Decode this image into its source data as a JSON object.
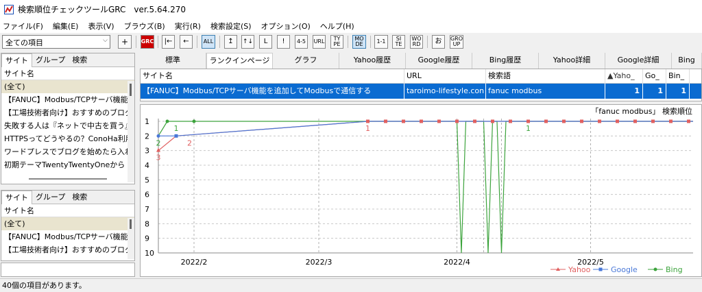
{
  "window": {
    "title": "検索順位チェックツールGRC　ver.5.64.270"
  },
  "menu": [
    "ファイル(F)",
    "編集(E)",
    "表示(V)",
    "ブラウズ(B)",
    "実行(R)",
    "検索設定(S)",
    "オプション(O)",
    "ヘルプ(H)"
  ],
  "toolbar": {
    "combo_value": "全ての項目",
    "buttons": [
      "+",
      "GRC",
      "|←",
      "←",
      "ALL",
      "↥",
      "↑↓",
      "L",
      "!",
      "4-5",
      "URL",
      "TY PE",
      "MO DE",
      "1-1",
      "SI TE",
      "WO RD",
      "お",
      "GRO UP"
    ]
  },
  "left_panel_top": {
    "tabs": [
      "サイト",
      "グループ",
      "検索"
    ],
    "header": "サイト名",
    "items": [
      "(全て)",
      "【FANUC】Modbus/TCPサーバ機能",
      "【工場技術者向け】おすすめのブログ立",
      "失敗する人は『ネットで中古を買う』|",
      "HTTPSってどうやるの？ConoHa利用",
      "ワードプレスでブログを始めたら入れるブ",
      "初期テーマTwentyTwentyOneから"
    ]
  },
  "left_panel_bottom": {
    "tabs": [
      "サイト",
      "グループ",
      "検索"
    ],
    "header": "サイト名",
    "items": [
      "(全て)",
      "【FANUC】Modbus/TCPサーバ機能",
      "【工場技術者向け】おすすめのブログ立"
    ]
  },
  "right_tabs": [
    "標準",
    "ランクインページ",
    "グラフ",
    "Yahoo履歴",
    "Google履歴",
    "Bing履歴",
    "Yahoo詳細",
    "Google詳細",
    "Bing"
  ],
  "grid": {
    "headers": [
      "サイト名",
      "URL",
      "検索語",
      "▲Yaho_",
      "Go_",
      "Bin_"
    ],
    "row": [
      "【FANUC】Modbus/TCPサーバ機能を追加してModbusで通信する",
      "taroimo-lifestyle.con",
      "fanuc modbus",
      "1",
      "1",
      "1"
    ]
  },
  "chart_data": {
    "type": "line",
    "title": "「fanuc modbus」 検索順位",
    "y_ticks": [
      "1",
      "2",
      "3",
      "4",
      "5",
      "6",
      "7",
      "8",
      "9",
      "10"
    ],
    "ylim": [
      10,
      1
    ],
    "x_tick_labels": [
      "2022/2",
      "2022/3",
      "2022/4",
      "2022/5"
    ],
    "x_range": [
      "2022-01-24",
      "2022-05-24"
    ],
    "series": [
      {
        "name": "Yahoo",
        "color": "#e06060",
        "points": [
          [
            "2022-01-24",
            3
          ],
          [
            "2022-01-28",
            2
          ],
          [
            "2022-03-12",
            1
          ],
          [
            "2022-05-24",
            1
          ]
        ]
      },
      {
        "name": "Google",
        "color": "#4a78d8",
        "points": [
          [
            "2022-01-24",
            2
          ],
          [
            "2022-01-28",
            2
          ],
          [
            "2022-03-12",
            1
          ],
          [
            "2022-05-24",
            1
          ]
        ]
      },
      {
        "name": "Bing",
        "color": "#3ca33c",
        "points": [
          [
            "2022-01-24",
            2
          ],
          [
            "2022-01-26",
            1
          ],
          [
            "2022-02-01",
            1
          ],
          [
            "2022-04-01",
            1
          ],
          [
            "2022-04-02",
            10
          ],
          [
            "2022-04-03",
            1
          ],
          [
            "2022-04-07",
            1
          ],
          [
            "2022-04-08",
            10
          ],
          [
            "2022-04-09",
            1
          ],
          [
            "2022-04-10",
            1
          ],
          [
            "2022-04-11",
            10
          ],
          [
            "2022-04-12",
            1
          ],
          [
            "2022-05-24",
            1
          ]
        ]
      }
    ],
    "point_labels": [
      {
        "text": "3",
        "series": "Yahoo",
        "at": [
          "2022-01-24",
          3
        ]
      },
      {
        "text": "2",
        "series": "Bing",
        "at": [
          "2022-01-24",
          2
        ]
      },
      {
        "text": "1",
        "series": "Bing",
        "at": [
          "2022-01-28",
          1
        ]
      },
      {
        "text": "2",
        "series": "Yahoo",
        "at": [
          "2022-01-31",
          2
        ]
      },
      {
        "text": "1",
        "series": "Yahoo",
        "at": [
          "2022-03-12",
          1
        ]
      },
      {
        "text": "1",
        "series": "Bing",
        "at": [
          "2022-04-17",
          1
        ]
      }
    ],
    "legend": [
      "Yahoo",
      "Google",
      "Bing"
    ],
    "legend_position": "bottom-right"
  },
  "status": {
    "text": "40個の項目があります。"
  }
}
